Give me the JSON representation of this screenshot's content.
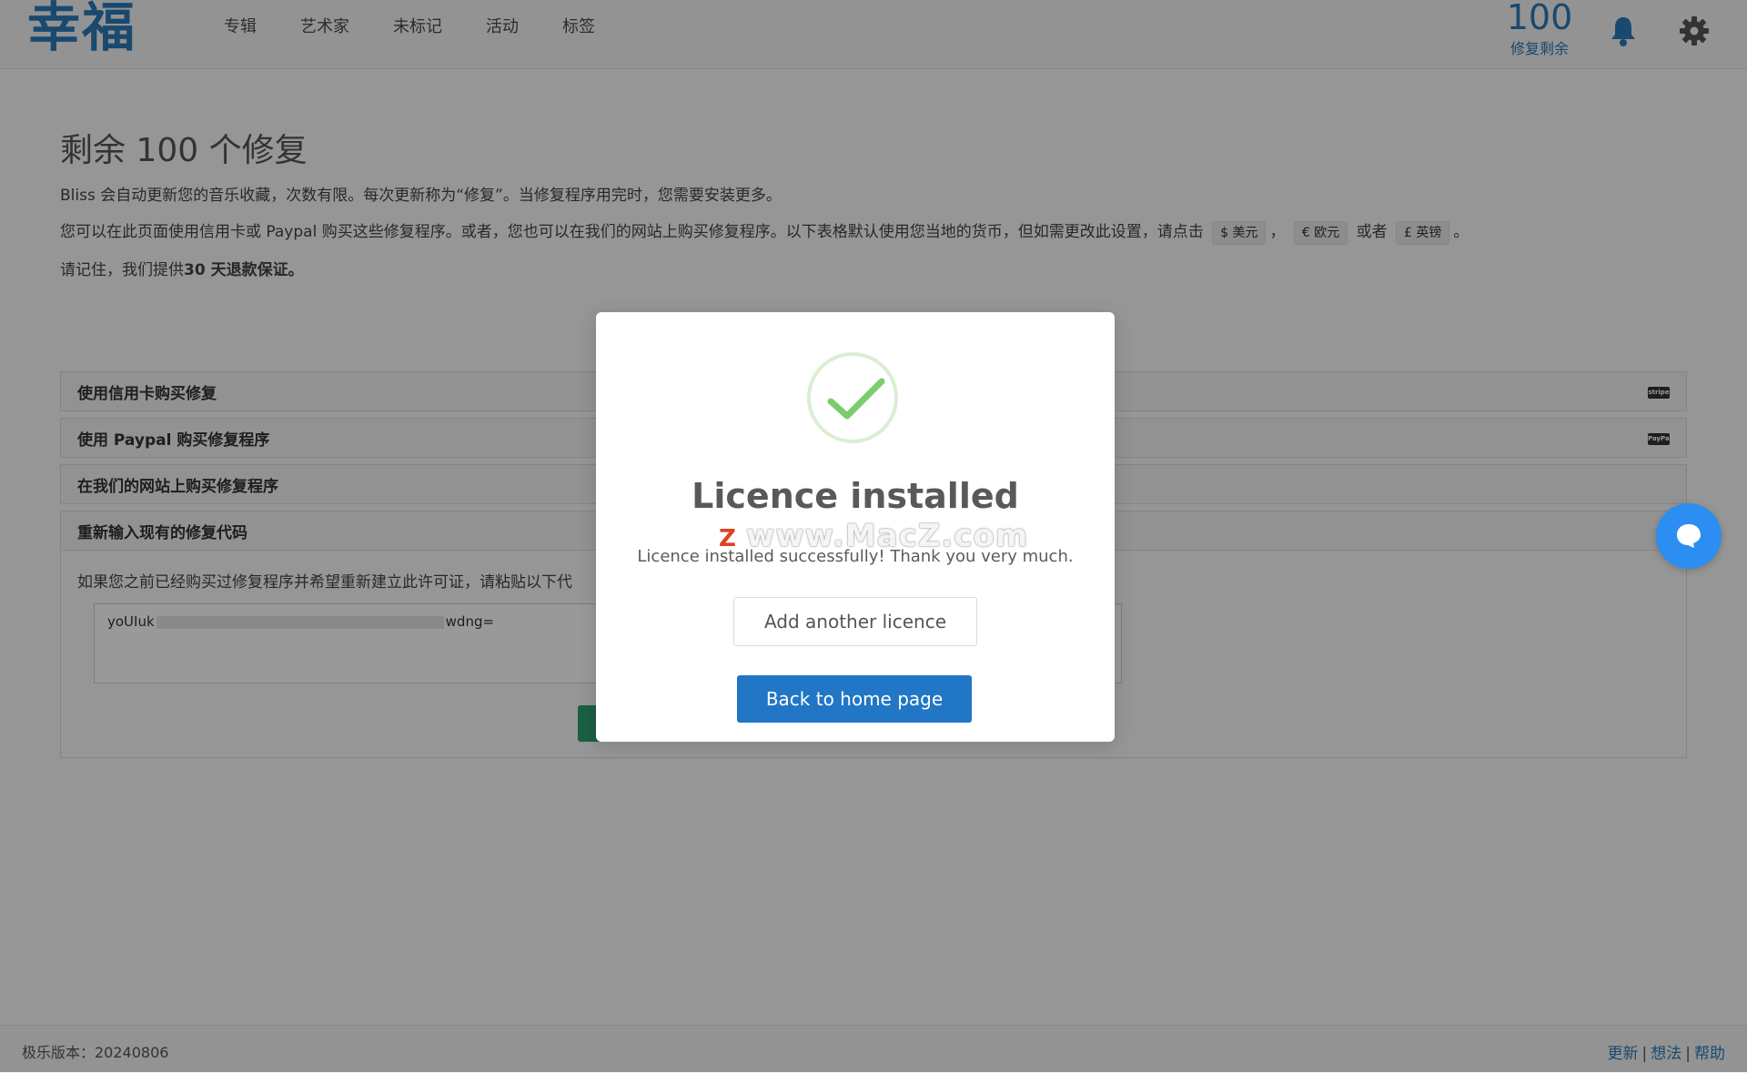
{
  "app": {
    "logo": "幸福",
    "nav": [
      "专辑",
      "艺术家",
      "未标记",
      "活动",
      "标签"
    ],
    "fix_count": "100",
    "fix_label": "修复剩余"
  },
  "main": {
    "title": "剩余 100 个修复",
    "para1": "Bliss 会自动更新您的音乐收藏，次数有限。每次更新称为“修复”。当修复程序用完时，您需要安装更多。",
    "para2_text": "您可以在此页面使用信用卡或 Paypal 购买这些修复程序。或者，您也可以在我们的网站上购买修复程序。以下表格默认使用您当地的货币，但如需更改此设置，请点击",
    "currency_usd": "$ 美元",
    "currency_eur": "€ 欧元",
    "currency_or": "或者",
    "currency_gbp": "£ 英镑",
    "para3_prefix": "请记住，我们提供",
    "para3_bold": "30 天退款保证。",
    "panels": [
      {
        "label": "使用信用卡购买修复",
        "badge": "stripe"
      },
      {
        "label": "使用 Paypal 购买修复程序",
        "badge": "PayPal"
      },
      {
        "label": "在我们的网站上购买修复程序",
        "badge": ""
      },
      {
        "label": "重新输入现有的修复代码",
        "badge": ""
      }
    ],
    "reenter_hint": "如果您之前已经购买过修复程序并希望重新建立此许可证，请粘贴以下代",
    "code_prefix": "yoUIuk",
    "code_suffix": "wdng="
  },
  "modal": {
    "title": "Licence installed",
    "watermark": "www.MacZ.com",
    "message": "Licence installed successfully! Thank you very much.",
    "add_label": "Add another licence",
    "home_label": "Back to home page"
  },
  "footer": {
    "version": "极乐版本：20240806",
    "links": [
      "更新",
      "想法",
      "帮助"
    ]
  },
  "colors": {
    "brand": "#2a7ab9",
    "primary_button": "#2176c5",
    "success_check": "#7dcc6e",
    "chat": "#2b8ef0"
  }
}
